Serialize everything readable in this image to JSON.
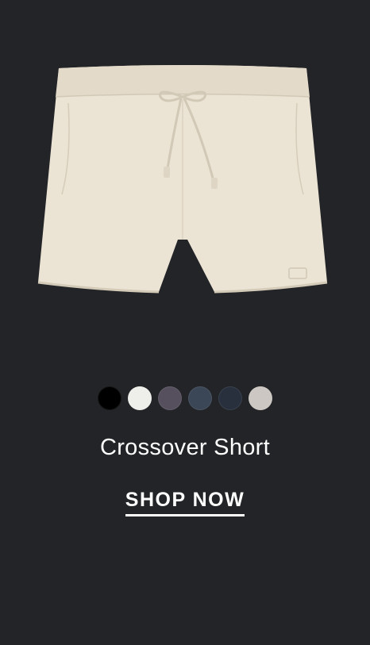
{
  "product": {
    "name": "Crossover Short",
    "cta_label": "SHOP NOW",
    "image_icon": "shorts-image",
    "garment_color": "#EBE3D4",
    "swatches": [
      {
        "name": "black",
        "color": "#000000"
      },
      {
        "name": "off-white",
        "color": "#EEEEEA"
      },
      {
        "name": "plum-gray",
        "color": "#56505E"
      },
      {
        "name": "slate-blue",
        "color": "#3B4656"
      },
      {
        "name": "navy",
        "color": "#28303E"
      },
      {
        "name": "stone",
        "color": "#CCC7C2"
      }
    ]
  },
  "colors": {
    "background": "#222427",
    "text": "#FFFFFF"
  }
}
